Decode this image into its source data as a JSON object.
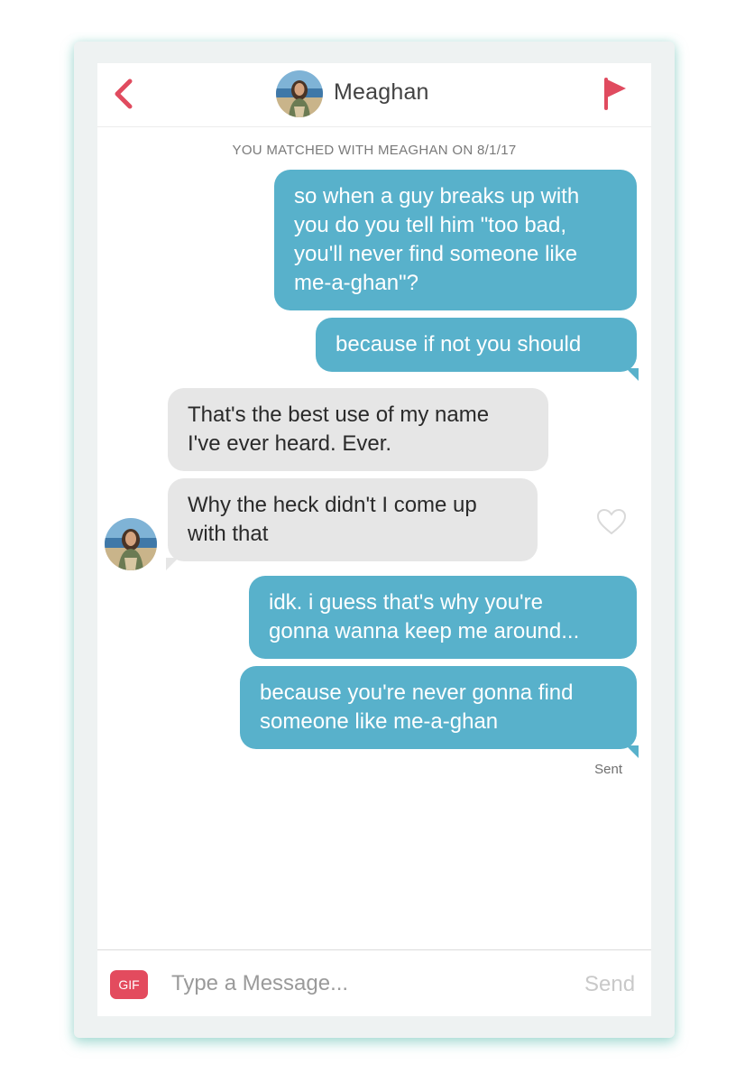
{
  "header": {
    "back_icon": "chevron-left-icon",
    "contact_name": "Meaghan",
    "report_icon": "flag-icon",
    "accent_color": "#e04b5f"
  },
  "match_banner": "YOU MATCHED WITH MEAGHAN ON 8/1/17",
  "messages": [
    {
      "from": "me",
      "text": "so when a guy breaks up with\nyou do you tell him \"too bad,\nyou'll never find someone like\nme-a-ghan\"?"
    },
    {
      "from": "me",
      "text": "because if not you should"
    },
    {
      "from": "them",
      "text": "That's the best use of my name\nI've ever heard. Ever."
    },
    {
      "from": "them",
      "text": "Why the heck didn't I come up\nwith that"
    },
    {
      "from": "me",
      "text": "idk. i guess that's why you're\ngonna wanna keep me around..."
    },
    {
      "from": "me",
      "text": "because you're never gonna find\nsomeone like me-a-ghan"
    }
  ],
  "status": "Sent",
  "like_icon": "heart-outline-icon",
  "composer": {
    "gif_label": "GIF",
    "placeholder": "Type a Message...",
    "send_label": "Send"
  },
  "colors": {
    "sent_bubble": "#58b1cb",
    "received_bubble": "#e6e6e6",
    "gif_button": "#e34b5e"
  }
}
